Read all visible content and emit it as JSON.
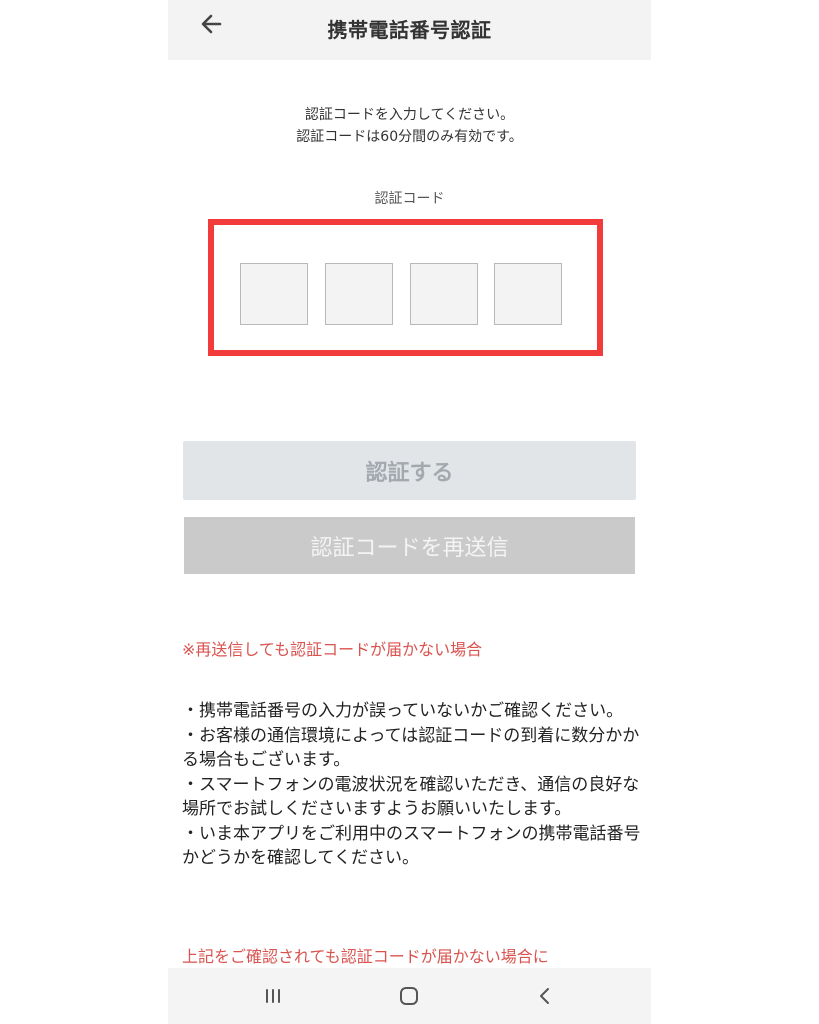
{
  "header": {
    "title": "携帯電話番号認証",
    "back_icon": "arrow-left-icon"
  },
  "intro": {
    "line1": "認証コードを入力してください。",
    "line2": "認証コードは60分間のみ有効です。"
  },
  "code": {
    "label": "認証コード",
    "digits": [
      "",
      "",
      "",
      ""
    ]
  },
  "buttons": {
    "verify_label": "認証する",
    "resend_label": "認証コードを再送信"
  },
  "notice": {
    "title": "※再送信しても認証コードが届かない場合",
    "items": [
      "・携帯電話番号の入力が誤っていないかご確認ください。",
      "・お客様の通信環境によっては認証コードの到着に数分かかる場合もございます。",
      "・スマートフォンの電波状況を確認いただき、通信の良好な場所でお試しくださいますようお願いいたします。",
      "・いま本アプリをご利用中のスマートフォンの携帯電話番号かどうかを確認してください。"
    ],
    "footer": "上記をご確認されても認証コードが届かない場合に"
  },
  "navbar": {
    "recents_icon": "recent-apps-icon",
    "home_icon": "home-icon",
    "back_icon": "chevron-left-icon"
  },
  "colors": {
    "highlight": "#f23c3c",
    "notice": "#d9534f",
    "header_bg": "#f3f3f3"
  }
}
